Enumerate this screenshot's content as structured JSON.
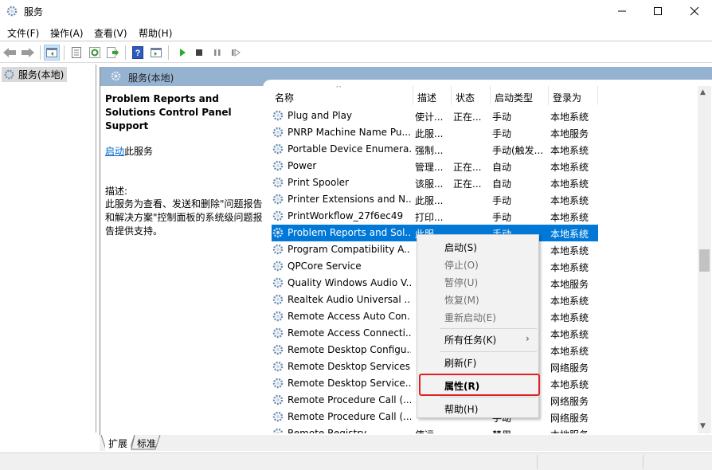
{
  "window": {
    "title": "服务",
    "minimize_label": "—",
    "maximize_label": "☐",
    "close_label": "✕"
  },
  "menubar": {
    "items": [
      {
        "label": "文件(F)"
      },
      {
        "label": "操作(A)"
      },
      {
        "label": "查看(V)"
      },
      {
        "label": "帮助(H)"
      }
    ]
  },
  "toolbar": {
    "buttons": [
      "back-icon",
      "forward-icon",
      "show-hide-tree-icon",
      "properties-icon",
      "refresh-icon",
      "export-list-icon",
      "help-icon",
      "action-pane-icon",
      "start-service-icon",
      "stop-service-icon",
      "pause-service-icon",
      "restart-service-icon"
    ]
  },
  "tree": {
    "node_label": "服务(本地)"
  },
  "pane": {
    "header_title": "服务(本地)",
    "extended": {
      "service_name": "Problem Reports and Solutions Control Panel Support",
      "action_link": "启动",
      "action_suffix": "此服务",
      "desc_label": "描述:",
      "description": "此服务为查看、发送和删除\"问题报告和解决方案\"控制面板的系统级问题报告提供支持。"
    },
    "columns": [
      "名称",
      "描述",
      "状态",
      "启动类型",
      "登录为"
    ],
    "sort_indicator": "^",
    "rows": [
      {
        "name": "Plug and Play",
        "desc": "使计...",
        "status": "正在...",
        "startup": "手动",
        "logon": "本地系统"
      },
      {
        "name": "PNRP Machine Name Pu...",
        "desc": "此服...",
        "status": "",
        "startup": "手动",
        "logon": "本地服务"
      },
      {
        "name": "Portable Device Enumera...",
        "desc": "强制...",
        "status": "",
        "startup": "手动(触发...",
        "logon": "本地系统"
      },
      {
        "name": "Power",
        "desc": "管理...",
        "status": "正在...",
        "startup": "自动",
        "logon": "本地系统"
      },
      {
        "name": "Print Spooler",
        "desc": "该服...",
        "status": "正在...",
        "startup": "自动",
        "logon": "本地系统"
      },
      {
        "name": "Printer Extensions and N...",
        "desc": "此服...",
        "status": "",
        "startup": "手动",
        "logon": "本地系统"
      },
      {
        "name": "PrintWorkflow_27f6ec49",
        "desc": "打印...",
        "status": "",
        "startup": "手动",
        "logon": "本地系统"
      },
      {
        "name": "Problem Reports and Sol...",
        "desc": "此服...",
        "status": "",
        "startup": "手动",
        "logon": "本地系统",
        "selected": true
      },
      {
        "name": "Program Compatibility A...",
        "desc": "",
        "status": "",
        "startup": "",
        "logon": "本地系统"
      },
      {
        "name": "QPCore Service",
        "desc": "",
        "status": "",
        "startup": "",
        "logon": "本地系统"
      },
      {
        "name": "Quality Windows Audio V...",
        "desc": "",
        "status": "",
        "startup": "",
        "logon": "本地服务"
      },
      {
        "name": "Realtek Audio Universal ...",
        "desc": "",
        "status": "",
        "startup": "",
        "logon": "本地系统"
      },
      {
        "name": "Remote Access Auto Con...",
        "desc": "",
        "status": "",
        "startup": "",
        "logon": "本地系统"
      },
      {
        "name": "Remote Access Connecti...",
        "desc": "",
        "status": "",
        "startup": "",
        "logon": "本地系统"
      },
      {
        "name": "Remote Desktop Configu...",
        "desc": "",
        "status": "",
        "startup": "",
        "logon": "本地系统"
      },
      {
        "name": "Remote Desktop Services",
        "desc": "",
        "status": "",
        "startup": "",
        "logon": "网络服务"
      },
      {
        "name": "Remote Desktop Service...",
        "desc": "",
        "status": "",
        "startup": "",
        "logon": "本地系统"
      },
      {
        "name": "Remote Procedure Call (...",
        "desc": "",
        "status": "",
        "startup": "",
        "logon": "网络服务"
      },
      {
        "name": "Remote Procedure Call (...",
        "desc": "",
        "status": "",
        "startup": "手动",
        "logon": "网络服务"
      },
      {
        "name": "Remote Registry",
        "desc": "使远...",
        "status": "",
        "startup": "禁用",
        "logon": "本地服务"
      }
    ]
  },
  "context_menu": {
    "items": [
      {
        "label": "启动(S)",
        "enabled": true
      },
      {
        "label": "停止(O)",
        "enabled": false
      },
      {
        "label": "暂停(U)",
        "enabled": false
      },
      {
        "label": "恢复(M)",
        "enabled": false
      },
      {
        "label": "重新启动(E)",
        "enabled": false
      },
      {
        "label": "所有任务(K)",
        "enabled": true,
        "submenu": true
      },
      {
        "label": "刷新(F)",
        "enabled": true
      },
      {
        "label": "属性(R)",
        "enabled": true,
        "bold": true,
        "highlighted": true
      },
      {
        "label": "帮助(H)",
        "enabled": true
      }
    ],
    "submenu_arrow": "›"
  },
  "bottom_tabs": [
    {
      "label": "扩展",
      "active": true
    },
    {
      "label": "标准",
      "active": false
    }
  ],
  "colors": {
    "selection": "#0078d7",
    "pane_header": "#96b2d1",
    "highlight_box": "#e02020",
    "link": "#0066cc"
  }
}
